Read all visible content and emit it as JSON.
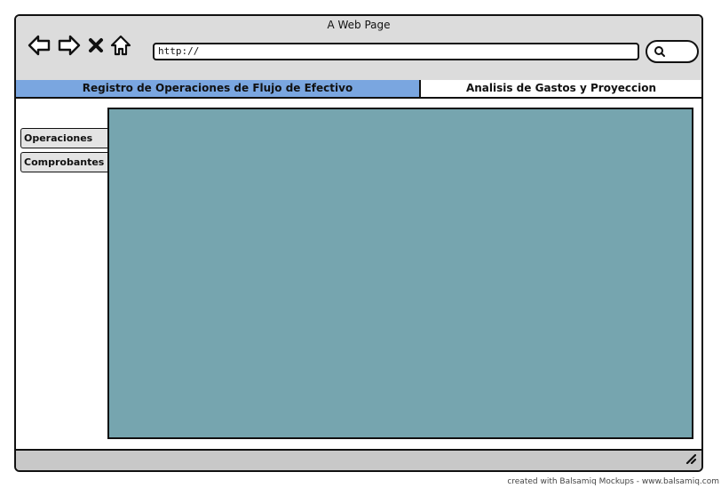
{
  "window": {
    "title": "A Web Page"
  },
  "toolbar": {
    "address_value": "http://",
    "nav_icons": [
      "back-arrow-icon",
      "forward-arrow-icon",
      "close-icon",
      "home-icon"
    ],
    "search_icon": "search-icon"
  },
  "tabs": [
    {
      "label": "Registro de Operaciones de Flujo de Efectivo",
      "active": true
    },
    {
      "label": "Analisis de Gastos y Proyeccion",
      "active": false
    }
  ],
  "side_tabs": [
    {
      "label": "Operaciones"
    },
    {
      "label": "Comprobantes"
    }
  ],
  "colors": {
    "active_tab": "#7aa6e0",
    "content_panel": "#76a5af",
    "chrome": "#dcdcdc",
    "statusbar": "#c8c8c8"
  },
  "footer": {
    "credit": "created with Balsamiq Mockups - www.balsamiq.com"
  }
}
